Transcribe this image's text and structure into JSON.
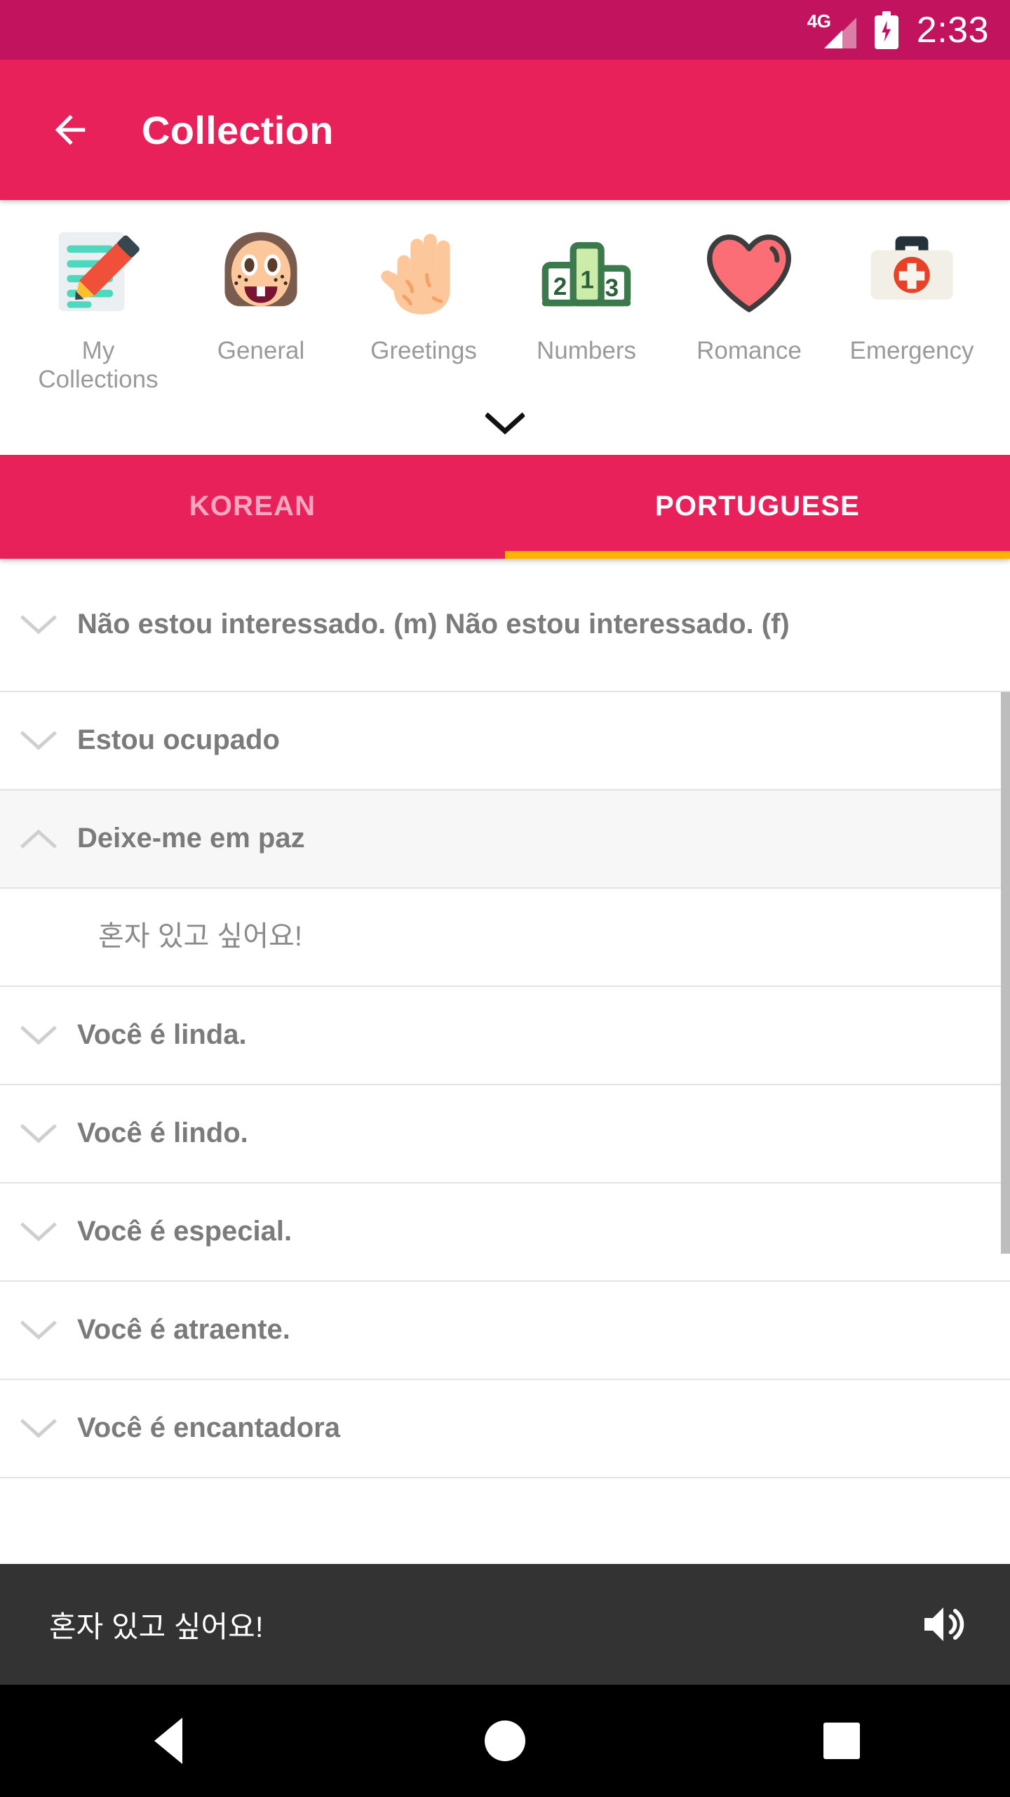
{
  "statusbar": {
    "network": "4G",
    "time": "2:33",
    "signal_icon": "signal-bars-icon",
    "battery_icon": "battery-charging-icon"
  },
  "appbar": {
    "title": "Collection",
    "back_icon": "arrow-left-icon"
  },
  "categories": {
    "expand_icon": "chevron-down-icon",
    "items": [
      {
        "label": "My Collections",
        "icon": "memo-pencil-icon"
      },
      {
        "label": "General",
        "icon": "girl-face-icon"
      },
      {
        "label": "Greetings",
        "icon": "open-hand-icon"
      },
      {
        "label": "Numbers",
        "icon": "podium-123-icon"
      },
      {
        "label": "Romance",
        "icon": "heart-icon"
      },
      {
        "label": "Emergency",
        "icon": "first-aid-kit-icon"
      }
    ]
  },
  "tabs": {
    "items": [
      {
        "label": "KOREAN",
        "active": false
      },
      {
        "label": "PORTUGUESE",
        "active": true
      }
    ],
    "indicator_color": "#ffb300"
  },
  "phrases": [
    {
      "text": "Não estou interessado. (m)  Não estou interessado. (f)",
      "expanded": false,
      "chevron": "chevron-down-icon",
      "lines": 2
    },
    {
      "text": "Estou ocupado",
      "expanded": false,
      "chevron": "chevron-down-icon",
      "lines": 1
    },
    {
      "text": "Deixe-me em paz",
      "expanded": true,
      "chevron": "chevron-up-icon",
      "lines": 1,
      "translation": "혼자 있고 싶어요!"
    },
    {
      "text": "Você é linda.",
      "expanded": false,
      "chevron": "chevron-down-icon",
      "lines": 1
    },
    {
      "text": "Você é lindo.",
      "expanded": false,
      "chevron": "chevron-down-icon",
      "lines": 1
    },
    {
      "text": "Você é especial.",
      "expanded": false,
      "chevron": "chevron-down-icon",
      "lines": 1
    },
    {
      "text": "Você é atraente.",
      "expanded": false,
      "chevron": "chevron-down-icon",
      "lines": 1
    },
    {
      "text": "Você é encantadora",
      "expanded": false,
      "chevron": "chevron-down-icon",
      "lines": 1
    }
  ],
  "playbar": {
    "text": "혼자 있고 싶어요!",
    "speaker_icon": "volume-up-icon"
  },
  "navbar": {
    "back_icon": "nav-back-triangle-icon",
    "home_icon": "nav-home-circle-icon",
    "recents_icon": "nav-recents-square-icon"
  },
  "colors": {
    "status_bar": "#c2135f",
    "app_bar": "#e8215b",
    "accent": "#ffb300",
    "playbar": "#333333"
  }
}
